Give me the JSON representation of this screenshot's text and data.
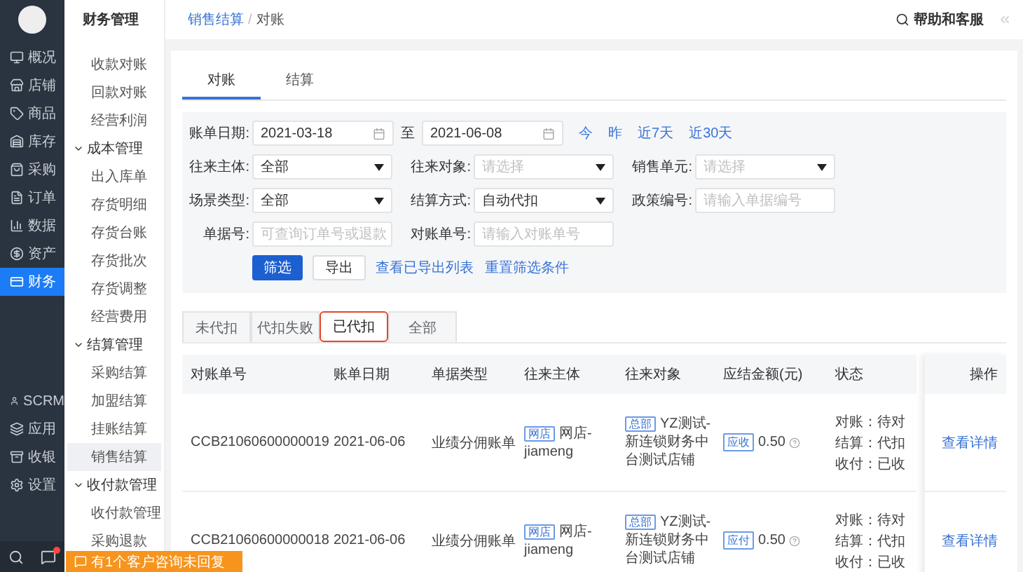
{
  "sidebar": {
    "items": [
      {
        "label": "概况",
        "selected": false
      },
      {
        "label": "店铺",
        "selected": false
      },
      {
        "label": "商品",
        "selected": false
      },
      {
        "label": "库存",
        "selected": false
      },
      {
        "label": "采购",
        "selected": false
      },
      {
        "label": "订单",
        "selected": false
      },
      {
        "label": "数据",
        "selected": false
      },
      {
        "label": "资产",
        "selected": false
      },
      {
        "label": "财务",
        "selected": true
      }
    ],
    "bottom_items": [
      {
        "label": "SCRM",
        "selected": false
      },
      {
        "label": "应用",
        "selected": false
      },
      {
        "label": "收银",
        "selected": false
      },
      {
        "label": "设置",
        "selected": false
      }
    ],
    "unread": true
  },
  "subnav": {
    "title": "财务管理",
    "items": [
      {
        "label": "收款对账",
        "selected": false
      },
      {
        "label": "回款对账",
        "selected": false
      },
      {
        "label": "经营利润",
        "selected": false
      },
      {
        "label": "成本管理",
        "expanded": true,
        "children": [
          {
            "label": "出入库单",
            "selected": false
          },
          {
            "label": "存货明细",
            "selected": false
          },
          {
            "label": "存货台账",
            "selected": false
          },
          {
            "label": "存货批次",
            "selected": false
          },
          {
            "label": "存货调整",
            "selected": false
          },
          {
            "label": "经营费用",
            "selected": false
          }
        ]
      },
      {
        "label": "结算管理",
        "expanded": true,
        "children": [
          {
            "label": "采购结算",
            "selected": false
          },
          {
            "label": "加盟结算",
            "selected": false
          },
          {
            "label": "挂账结算",
            "selected": false
          },
          {
            "label": "销售结算",
            "selected": true
          }
        ]
      },
      {
        "label": "收付款管理",
        "expanded": true,
        "children": [
          {
            "label": "收付款管理",
            "selected": false
          },
          {
            "label": "采购退款",
            "selected": false
          }
        ]
      }
    ]
  },
  "banner": {
    "text": "有1个客户咨询未回复"
  },
  "breadcrumb": [
    "销售结算",
    "对账"
  ],
  "breadcrumb_separator": "/",
  "help": "帮助和客服",
  "tabs": [
    {
      "label": "对账",
      "selected": true
    },
    {
      "label": "结算",
      "selected": false
    }
  ],
  "filters": {
    "date": {
      "label": "账单日期:",
      "from": "2021-03-18",
      "separator": "至",
      "to": "2021-06-08",
      "quick": [
        "今",
        "昨",
        "近7天",
        "近30天"
      ]
    },
    "rows": [
      [
        {
          "label": "往来主体:",
          "kind": "select",
          "value": "全部"
        },
        {
          "label": "往来对象:",
          "kind": "select",
          "placeholder": "请选择"
        },
        {
          "label": "销售单元:",
          "kind": "select",
          "placeholder": "请选择"
        }
      ],
      [
        {
          "label": "场景类型:",
          "kind": "select",
          "value": "全部"
        },
        {
          "label": "结算方式:",
          "kind": "select",
          "value": "自动代扣"
        },
        {
          "label": "政策编号:",
          "kind": "input",
          "placeholder": "请输入单据编号"
        }
      ],
      [
        {
          "label": "单据号:",
          "kind": "input",
          "placeholder": "可查询订单号或退款"
        },
        {
          "label": "对账单号:",
          "kind": "input",
          "placeholder": "请输入对账单号"
        }
      ]
    ],
    "actions": [
      {
        "label": "筛选",
        "kind": "primary"
      },
      {
        "label": "导出",
        "kind": "default"
      },
      {
        "label": "查看已导出列表",
        "kind": "link"
      },
      {
        "label": "重置筛选条件",
        "kind": "link"
      }
    ]
  },
  "status_tabs": [
    {
      "label": "未代扣",
      "selected": false,
      "highlighted": false
    },
    {
      "label": "代扣失败",
      "selected": false,
      "highlighted": false
    },
    {
      "label": "已代扣",
      "selected": true,
      "highlighted": true
    },
    {
      "label": "全部",
      "selected": false,
      "highlighted": false
    }
  ],
  "table": {
    "columns": [
      "对账单号",
      "账单日期",
      "单据类型",
      "往来主体",
      "往来对象",
      "应结金额(元)",
      "状态",
      "操作"
    ],
    "rows": [
      {
        "number": "CCB21060600000019",
        "date": "2021-06-06",
        "type": "业绩分佣账单",
        "party_tag": "网店",
        "party": "网店-jiameng",
        "target_tag": "总部",
        "target": "YZ测试-新连锁财务中台测试店铺",
        "amount_tag": "应收",
        "amount": "0.50",
        "status": [
          "对账：待对",
          "结算：代扣",
          "收付：已收"
        ],
        "action": "查看详情"
      },
      {
        "number": "CCB21060600000018",
        "date": "2021-06-06",
        "type": "业绩分佣账单",
        "party_tag": "网店",
        "party": "网店-jiameng",
        "target_tag": "总部",
        "target": "YZ测试-新连锁财务中台测试店铺",
        "amount_tag": "应付",
        "amount": "0.50",
        "status": [
          "对账：待对",
          "结算：代扣",
          "收付：已收"
        ],
        "action": "查看详情"
      }
    ]
  }
}
